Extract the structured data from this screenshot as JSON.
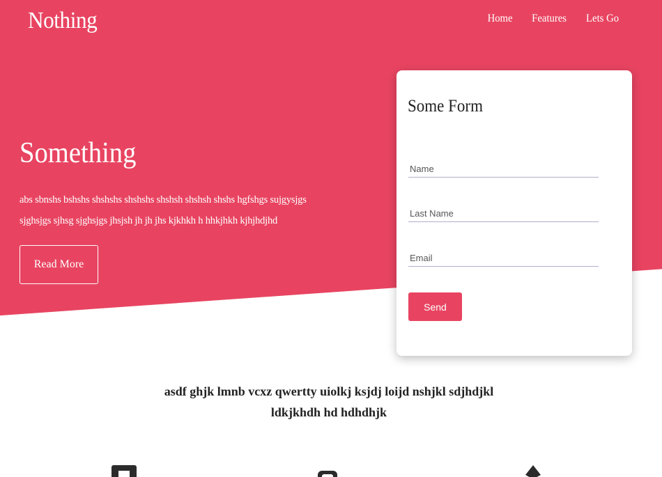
{
  "header": {
    "brand": "Nothing",
    "nav": [
      "Home",
      "Features",
      "Lets Go"
    ]
  },
  "hero": {
    "title": "Something",
    "text": "abs sbnshs bshshs shshshs shshshs shshsh shshsh shshs hgfshgs sujgysjgs sjghsjgs sjhsg sjghsjgs jhsjsh jh jh jhs kjkhkh h hhkjhkh kjhjhdjhd",
    "read_more_label": "Read More"
  },
  "form": {
    "title": "Some Form",
    "name_placeholder": "Name",
    "last_name_placeholder": "Last Name",
    "email_placeholder": "Email",
    "send_label": "Send"
  },
  "tagline": {
    "line1": "asdf ghjk lmnb vcxz qwertty uiolkj ksjdj loijd nshjkl sdjhdjkl",
    "line2": "ldkjkhdh hd hdhdhjk"
  },
  "features": {
    "icons": [
      "square-icon",
      "rounded-icon",
      "triangle-icon"
    ]
  },
  "colors": {
    "accent": "#e84461",
    "text_dark": "#222222",
    "white": "#ffffff"
  }
}
